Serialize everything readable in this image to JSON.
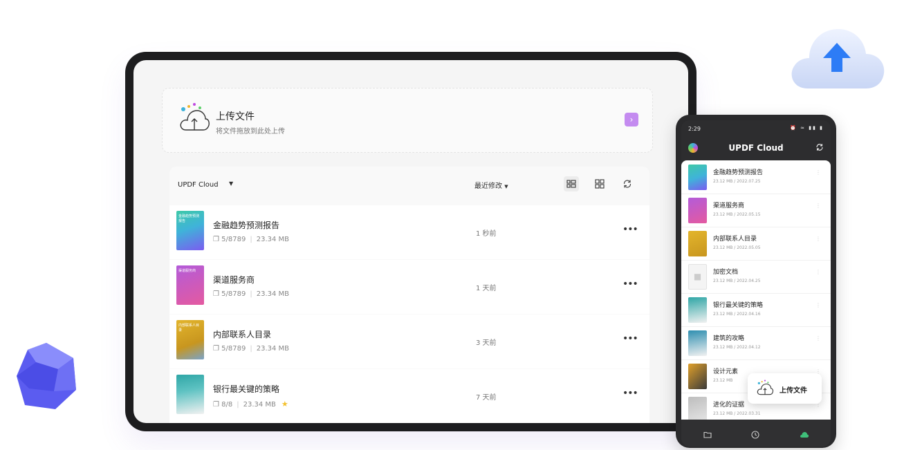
{
  "upload": {
    "title": "上传文件",
    "subtitle": "将文件拖放到此处上传",
    "action_icon": "chevron-right-icon"
  },
  "list": {
    "title": "UPDF Cloud",
    "sort_label": "最近修改",
    "icons": [
      "list-view-icon",
      "grid-view-icon",
      "refresh-icon"
    ],
    "items": [
      {
        "name": "金融趋势预测报告",
        "pages": "5/8789",
        "size": "23.34 MB",
        "time": "1 秒前",
        "thumb_label": "金融趋势预测报告",
        "thumb_color": "#3fb3d9",
        "starred": false
      },
      {
        "name": "渠道服务商",
        "pages": "5/8789",
        "size": "23.34 MB",
        "time": "1 天前",
        "thumb_label": "渠道服务商",
        "thumb_color": "#b35bd9",
        "starred": false
      },
      {
        "name": "内部联系人目录",
        "pages": "5/8789",
        "size": "23.34 MB",
        "time": "3 天前",
        "thumb_label": "内部联系人目录",
        "thumb_color": "#d4a72c",
        "starred": false
      },
      {
        "name": "银行最关键的策略",
        "pages": "8/8",
        "size": "23.34 MB",
        "time": "7 天前",
        "thumb_label": "",
        "thumb_color": "#2fa6a6",
        "starred": true
      }
    ]
  },
  "phone": {
    "status_time": "2:29",
    "title": "UPDF Cloud",
    "items": [
      {
        "name": "金融趋势预测报告",
        "meta": "23.12 MB / 2022.07.25",
        "thumb_color": "#3fb3d9"
      },
      {
        "name": "渠道服务商",
        "meta": "23.12 MB / 2022.05.15",
        "thumb_color": "#b35bd9"
      },
      {
        "name": "内部联系人目录",
        "meta": "23.12 MB / 2022.05.05",
        "thumb_color": "#d4a72c"
      },
      {
        "name": "加密文档",
        "meta": "23.12 MB / 2022.04.25",
        "thumb_color": "#f2f2f2"
      },
      {
        "name": "银行最关键的策略",
        "meta": "23.12 MB / 2022.04.16",
        "thumb_color": "#2fa6a6"
      },
      {
        "name": "建筑的攻略",
        "meta": "23.12 MB / 2022.04.12",
        "thumb_color": "#2f8fb0"
      },
      {
        "name": "设计元素",
        "meta": "23.12 MB",
        "thumb_color": "#e0a02a"
      },
      {
        "name": "进化的证据",
        "meta": "23.12 MB / 2022.03.31",
        "thumb_color": "#bdbdbd"
      }
    ],
    "nav": [
      "folder-icon",
      "clock-icon",
      "cloud-icon"
    ],
    "toast_label": "上传文件"
  }
}
